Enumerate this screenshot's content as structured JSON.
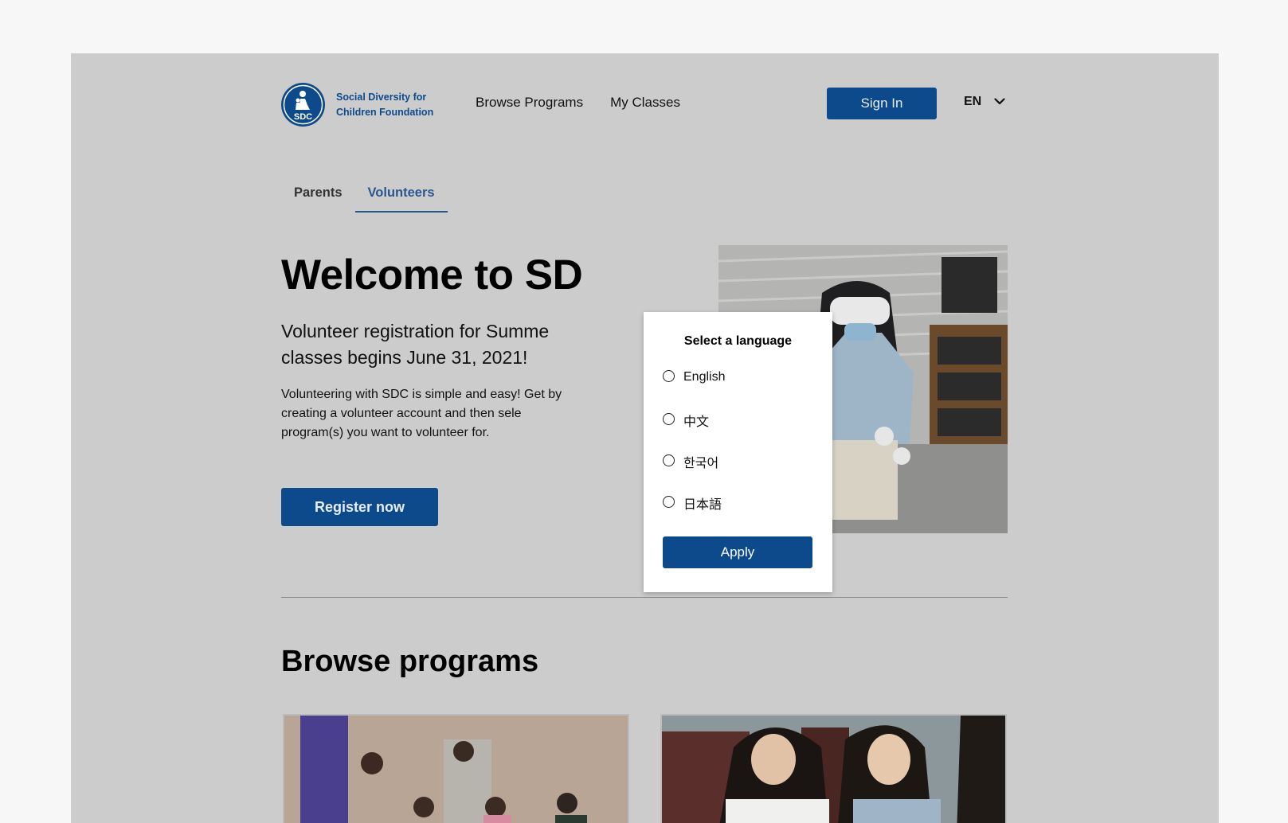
{
  "header": {
    "org_name_line1": "Social Diversity for",
    "org_name_line2": "Children Foundation",
    "logo_text": "SDC",
    "nav": [
      "Browse Programs",
      "My Classes"
    ],
    "sign_in_label": "Sign In",
    "language_code": "EN"
  },
  "tabs": [
    {
      "label": "Parents",
      "active": false
    },
    {
      "label": "Volunteers",
      "active": true
    }
  ],
  "hero": {
    "title": "Welcome to SD",
    "subtitle": "Volunteer registration for Summe classes begins June 31, 2021!",
    "body": "Volunteering with SDC is simple and easy! Get by creating a volunteer account and then sele program(s) you want to volunteer for.",
    "register_label": "Register now"
  },
  "browse": {
    "title": "Browse programs"
  },
  "language_modal": {
    "title": "Select a language",
    "options": [
      "English",
      "中文",
      "한국어",
      "日本語"
    ],
    "selected": null,
    "apply_label": "Apply"
  },
  "colors": {
    "brand": "#0d4a8c",
    "overlay_bg": "#cccccc",
    "page_bg": "#f7f7f7"
  }
}
